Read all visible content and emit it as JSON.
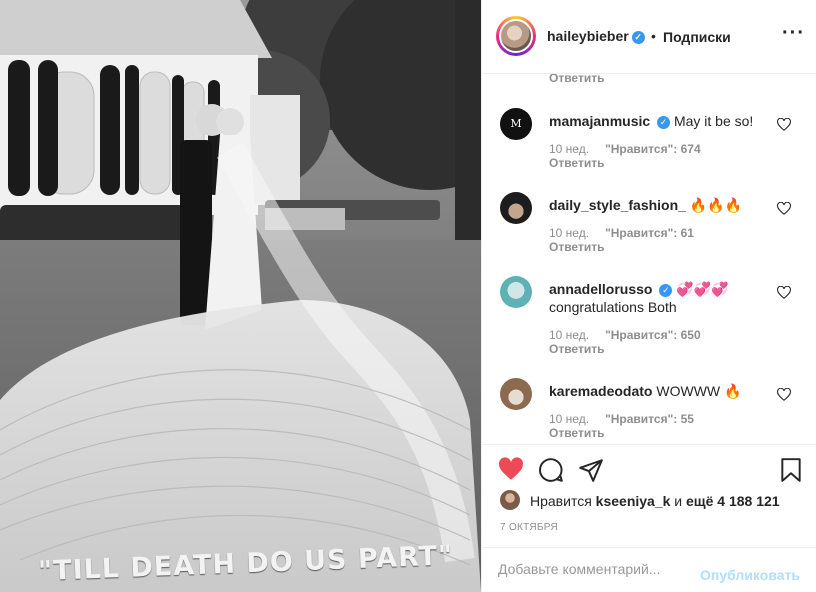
{
  "post": {
    "photo_caption": "\"TILL DEATH DO US PART\""
  },
  "header": {
    "username": "haileybieber",
    "verified_mark": "✓",
    "separator": "•",
    "follow_label": "Подписки",
    "more_label": "···"
  },
  "comments": {
    "top_reply": "Ответить",
    "items": [
      {
        "username": "mamajanmusic",
        "verified": true,
        "text": "May it be so!",
        "emoji": "",
        "time": "10 нед.",
        "likes": "\"Нравится\": 674",
        "reply": "Ответить",
        "avatar_icon": "mamajan-logo-avatar"
      },
      {
        "username": "daily_style_fashion_",
        "verified": false,
        "text": "",
        "emoji": "🔥🔥🔥",
        "time": "10 нед.",
        "likes": "\"Нравится\": 61",
        "reply": "Ответить",
        "avatar_icon": "hat-woman-avatar"
      },
      {
        "username": "annadellorusso",
        "verified": true,
        "text": "congratulations Both",
        "emoji": "💞💞💞",
        "time": "10 нед.",
        "likes": "\"Нравится\": 650",
        "reply": "Ответить",
        "avatar_icon": "teal-avatar"
      },
      {
        "username": "karemadeodato",
        "verified": false,
        "text": "WOWWW",
        "emoji": "🔥",
        "time": "10 нед.",
        "likes": "\"Нравится\": 55",
        "reply": "Ответить",
        "avatar_icon": "hat-avatar"
      }
    ]
  },
  "actions": {
    "like_icon": "heart-filled-icon",
    "comment_icon": "comment-icon",
    "share_icon": "share-icon",
    "save_icon": "bookmark-icon",
    "like_color": "#ed4956"
  },
  "likes": {
    "prefix": "Нравится",
    "user": "kseeniya_k",
    "middle": "и",
    "count": "ещё 4 188 121"
  },
  "date": "7 ОКТЯБРЯ",
  "comment_box": {
    "placeholder": "Добавьте комментарий...",
    "publish_label": "Опубликовать"
  }
}
